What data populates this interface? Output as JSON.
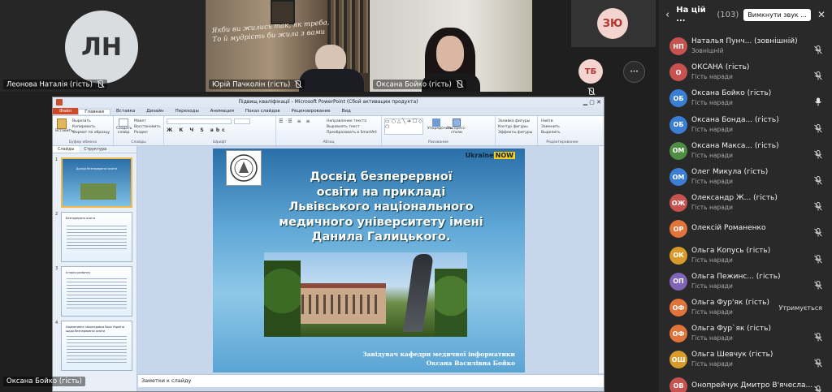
{
  "tiles": {
    "ln_initials": "ЛН",
    "ln_name": "Леонова Наталія (гість)",
    "yurii_name": "Юрій Пачколін (гість)",
    "oksana_name": "Оксана Бойко (гість)",
    "bottom_name": "Оксана Бойко (гість)",
    "zyu_initials": "ЗЮ",
    "tb_initials": "ТБ",
    "more_label": "···",
    "board_text_1": "Якби ви жились так, як треба,",
    "board_text_2": "То й мудрість би жила з вами"
  },
  "ppt": {
    "title": "Підвищ кваліфікації  -  Microsoft PowerPoint (Сбой активации продукта)",
    "tabs": [
      "Файл",
      "Главная",
      "Вставка",
      "Дизайн",
      "Переходы",
      "Анимация",
      "Показ слайдов",
      "Рецензирование",
      "Вид"
    ],
    "groups": [
      "Буфер обмена",
      "Слайды",
      "Шрифт",
      "Абзац",
      "Рисование",
      "Редактирование"
    ],
    "ribbon_items": {
      "paste": "Вставить",
      "cut": "Вырезать",
      "copy": "Копировать",
      "format_painter": "Формат по образцу",
      "new_slide": "Создать слайд",
      "layout": "Макет",
      "reset": "Восстановить",
      "section": "Раздел",
      "arrange": "Упорядочить",
      "quick_styles": "Экспресс-стили",
      "fill": "Заливка фигуры",
      "outline": "Контур фигуры",
      "effects": "Эффекты фигуры",
      "find": "Найти",
      "replace": "Заменить",
      "select": "Выделить",
      "text_direction": "Направление текста",
      "align_text": "Выровнять текст",
      "smartart": "Преобразовать в SmartArt"
    },
    "thumb_tabs": [
      "Слайды",
      "Структура"
    ],
    "slide": {
      "brand_text": "Ukraine",
      "brand_badge": "NOW",
      "title_lines": [
        "Досвід безперервної",
        "освіти на прикладі",
        "Львівського національного",
        "медичного університету імені",
        "Данила Галицького."
      ],
      "footer_line1": "Завідувач кафедри медичної інформатики",
      "footer_line2": "Оксана Василівна Бойко"
    },
    "thumb_titles": [
      "Досвід безперервної освіти",
      "Безперервна освіта",
      "Історія розвитку",
      "Нормативна законодавча база України щодо безперервної освіти"
    ],
    "thumb_numbers": [
      "1",
      "2",
      "3",
      "4"
    ],
    "notes_placeholder": "Заметки к слайду"
  },
  "panel": {
    "title": "На цій ...",
    "count": "(103)",
    "mute_all": "Вимкнути звук ...",
    "participants": [
      {
        "initials": "НП",
        "name": "Наталья Пунч... (зовнішній)",
        "sub": "Зовнішній",
        "color": "#c6534f",
        "mic": "off",
        "status": ""
      },
      {
        "initials": "О",
        "name": "ОКСАНА (гість)",
        "sub": "Гість наради",
        "color": "#c6534f",
        "mic": "off",
        "status": ""
      },
      {
        "initials": "ОБ",
        "name": "Оксана Бойко (гість)",
        "sub": "Гість наради",
        "color": "#3a7fd5",
        "mic": "on",
        "status": ""
      },
      {
        "initials": "ОБ",
        "name": "Оксана Бонда... (гість)",
        "sub": "Гість наради",
        "color": "#3a7fd5",
        "mic": "off",
        "status": ""
      },
      {
        "initials": "ОМ",
        "name": "Оксана Макса... (гість)",
        "sub": "Гість наради",
        "color": "#4f8d45",
        "mic": "off",
        "status": ""
      },
      {
        "initials": "ОМ",
        "name": "Олег Микула (гість)",
        "sub": "Гість наради",
        "color": "#3a7fd5",
        "mic": "off",
        "status": ""
      },
      {
        "initials": "ОЖ",
        "name": "Олександр Ж... (гість)",
        "sub": "Гість наради",
        "color": "#c6534f",
        "mic": "off",
        "status": ""
      },
      {
        "initials": "ОР",
        "name": "Олексій Романенко",
        "sub": "",
        "color": "#e0743a",
        "mic": "off",
        "status": ""
      },
      {
        "initials": "ОК",
        "name": "Ольга Копусь (гість)",
        "sub": "Гість наради",
        "color": "#d79a2b",
        "mic": "off",
        "status": ""
      },
      {
        "initials": "ОП",
        "name": "Ольга Пежинс... (гість)",
        "sub": "Гість наради",
        "color": "#8064b5",
        "mic": "off",
        "status": ""
      },
      {
        "initials": "ОФ",
        "name": "Ольга Фур'як (гість)",
        "sub": "Гість наради",
        "color": "#e0743a",
        "mic": "none",
        "status": "Утримується"
      },
      {
        "initials": "ОФ",
        "name": "Ольга Фур`як (гість)",
        "sub": "Гість наради",
        "color": "#e0743a",
        "mic": "off",
        "status": ""
      },
      {
        "initials": "ОШ",
        "name": "Ольга Шевчук (гість)",
        "sub": "Гість наради",
        "color": "#d79a2b",
        "mic": "off",
        "status": ""
      },
      {
        "initials": "ОВ",
        "name": "Онопрейчук Дмитро В'ячесла...",
        "sub": "",
        "color": "#c6534f",
        "mic": "off",
        "status": ""
      }
    ]
  }
}
